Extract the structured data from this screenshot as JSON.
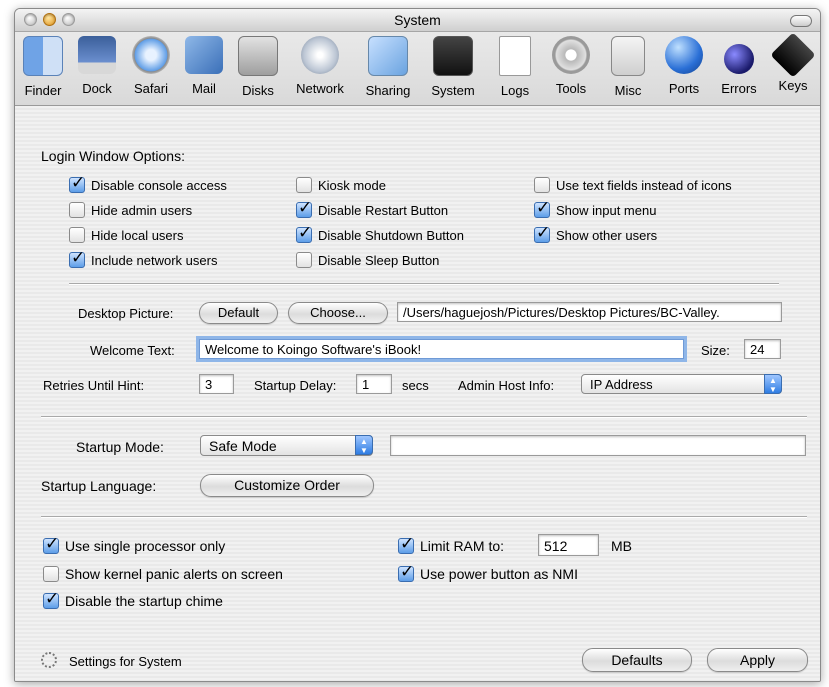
{
  "window": {
    "title": "System"
  },
  "toolbar": {
    "items": [
      {
        "label": "Finder",
        "icon": "finder-icon"
      },
      {
        "label": "Dock",
        "icon": "dock-icon"
      },
      {
        "label": "Safari",
        "icon": "safari-icon"
      },
      {
        "label": "Mail",
        "icon": "mail-icon"
      },
      {
        "label": "Disks",
        "icon": "disks-icon"
      },
      {
        "label": "Network",
        "icon": "network-icon"
      },
      {
        "label": "Sharing",
        "icon": "sharing-icon"
      },
      {
        "label": "System",
        "icon": "system-icon"
      },
      {
        "label": "Logs",
        "icon": "logs-icon"
      },
      {
        "label": "Tools",
        "icon": "tools-icon"
      },
      {
        "label": "Misc",
        "icon": "misc-icon"
      },
      {
        "label": "Ports",
        "icon": "ports-icon"
      },
      {
        "label": "Errors",
        "icon": "errors-icon"
      },
      {
        "label": "Keys",
        "icon": "keys-icon"
      }
    ]
  },
  "login": {
    "title": "Login Window Options:",
    "options": [
      {
        "label": "Disable console access",
        "checked": true
      },
      {
        "label": "Hide admin users",
        "checked": false
      },
      {
        "label": "Hide local users",
        "checked": false
      },
      {
        "label": "Include network users",
        "checked": true
      },
      {
        "label": "Kiosk mode",
        "checked": false
      },
      {
        "label": "Disable Restart Button",
        "checked": true
      },
      {
        "label": "Disable Shutdown Button",
        "checked": true
      },
      {
        "label": "Disable Sleep Button",
        "checked": false
      },
      {
        "label": "Use text fields instead of icons",
        "checked": false
      },
      {
        "label": "Show input menu",
        "checked": true
      },
      {
        "label": "Show other users",
        "checked": true
      }
    ]
  },
  "desktop": {
    "label": "Desktop Picture:",
    "default_button": "Default",
    "choose_button": "Choose...",
    "path": "/Users/haguejosh/Pictures/Desktop Pictures/BC-Valley."
  },
  "welcome": {
    "label": "Welcome Text:",
    "value": "Welcome to Koingo Software's iBook!",
    "size_label": "Size:",
    "size_value": "24"
  },
  "retries": {
    "label": "Retries Until Hint:",
    "value": "3"
  },
  "startup_delay": {
    "label": "Startup Delay:",
    "value": "1",
    "unit": "secs"
  },
  "admin_host": {
    "label": "Admin Host Info:",
    "value": "IP Address"
  },
  "startup_mode": {
    "label": "Startup Mode:",
    "value": "Safe Mode",
    "extra": ""
  },
  "startup_language": {
    "label": "Startup Language:",
    "button": "Customize Order"
  },
  "hardware": {
    "options": [
      {
        "label": "Use single processor only",
        "checked": true
      },
      {
        "label": "Show kernel panic alerts on screen",
        "checked": false
      },
      {
        "label": "Disable the startup chime",
        "checked": true
      },
      {
        "label": "Limit RAM to:",
        "checked": true
      },
      {
        "label": "Use power button as NMI",
        "checked": true
      }
    ],
    "ram_value": "512",
    "ram_unit": "MB"
  },
  "footer": {
    "settings_label": "Settings for System",
    "defaults_button": "Defaults",
    "apply_button": "Apply"
  },
  "colors": {
    "accent": "#3a7be0",
    "focus_ring": "#8fb6e8"
  }
}
